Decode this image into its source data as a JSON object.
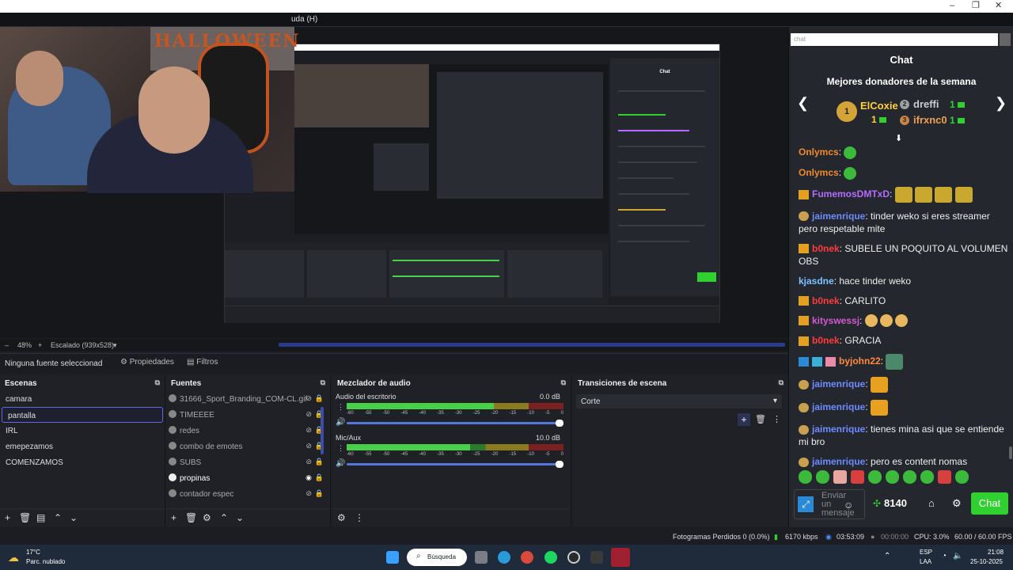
{
  "window": {
    "menu_help": "uda (H)"
  },
  "preview": {
    "zoom": "48%",
    "scale_label": "Escalado (939x528)",
    "webcam_text": "HALLOWEEN"
  },
  "properties_bar": {
    "no_source": "Ninguna fuente seleccionad",
    "properties": "Propiedades",
    "filters": "Filtros"
  },
  "scenes": {
    "title": "Escenas",
    "items": [
      "camara",
      "pantalla",
      "IRL",
      "emepezamos",
      "COMENZAMOS"
    ],
    "selected_index": 1
  },
  "sources": {
    "title": "Fuentes",
    "items": [
      "31666_Sport_Branding_COM-CL.gif",
      "TIMEEEE",
      "redes",
      "combo de emotes",
      "SUBS",
      "propinas",
      "contador espec"
    ]
  },
  "mixer": {
    "title": "Mezclador de audio",
    "channels": [
      {
        "name": "Audio del escritorio",
        "db": "0.0 dB",
        "level": 0.68
      },
      {
        "name": "Mic/Aux",
        "db": "10.0 dB",
        "level": 0.57
      }
    ],
    "ticks": [
      "-60",
      "-55",
      "-50",
      "-45",
      "-40",
      "-35",
      "-30",
      "-25",
      "-20",
      "-15",
      "-10",
      "-5",
      "0"
    ]
  },
  "transitions": {
    "title": "Transiciones de escena",
    "selected": "Corte"
  },
  "chat": {
    "address": "chat",
    "header": "Chat",
    "donors_title": "Mejores donadores de la semana",
    "donors": [
      {
        "rank": "1",
        "name": "ElCoxie",
        "count": "1"
      },
      {
        "rank": "2",
        "name": "dreffi",
        "count": "1"
      },
      {
        "rank": "3",
        "name": "ifrxnc0",
        "count": "1"
      }
    ],
    "messages": [
      {
        "user": "Onlymcs",
        "color": "#f08a2c",
        "text": ""
      },
      {
        "user": "Onlymcs",
        "color": "#f08a2c",
        "text": ""
      },
      {
        "user": "FumemosDMTxD",
        "color": "#b46bff",
        "text": ""
      },
      {
        "user": "jaimenrique",
        "color": "#6c8cff",
        "text": "tinder weko si eres streamer pero respetable mite"
      },
      {
        "user": "b0nek",
        "color": "#ff3b3b",
        "text": "SUBELE UN POQUITO AL VOLUMEN OBS"
      },
      {
        "user": "kjasdne",
        "color": "#7ec2ff",
        "text": "hace tinder weko"
      },
      {
        "user": "b0nek",
        "color": "#ff3b3b",
        "text": "CARLITO"
      },
      {
        "user": "kityswessj",
        "color": "#d35ad3",
        "text": ""
      },
      {
        "user": "b0nek",
        "color": "#ff3b3b",
        "text": "GRACIA"
      },
      {
        "user": "byjohn22",
        "color": "#ff8a3b",
        "text": ""
      },
      {
        "user": "jaimenrique",
        "color": "#6c8cff",
        "text": ""
      },
      {
        "user": "jaimenrique",
        "color": "#6c8cff",
        "text": ""
      },
      {
        "user": "jaimenrique",
        "color": "#6c8cff",
        "text": "tienes mina asi que se entiende mi bro"
      },
      {
        "user": "jaimenrique",
        "color": "#6c8cff",
        "text": "pero es content nomas"
      }
    ],
    "input_placeholder": "Enviar un mensaje",
    "points": "8140",
    "send": "Chat"
  },
  "status": {
    "frames_dropped": "Fotogramas Perdidos 0 (0.0%)",
    "bitrate": "6170 kbps",
    "stream_time": "03:53:09",
    "rec_time": "00:00:00",
    "cpu": "CPU: 3.0%",
    "fps": "60.00 / 60.00 FPS"
  },
  "taskbar": {
    "temp": "17°C",
    "weather": "Parc. nublado",
    "search": "Búsqueda",
    "lang1": "ESP",
    "lang2": "LAA",
    "time": "21:08",
    "date": "25-10-2025"
  },
  "colors": {
    "accent": "#5b6cd8",
    "chat_send": "#2fd02f"
  }
}
